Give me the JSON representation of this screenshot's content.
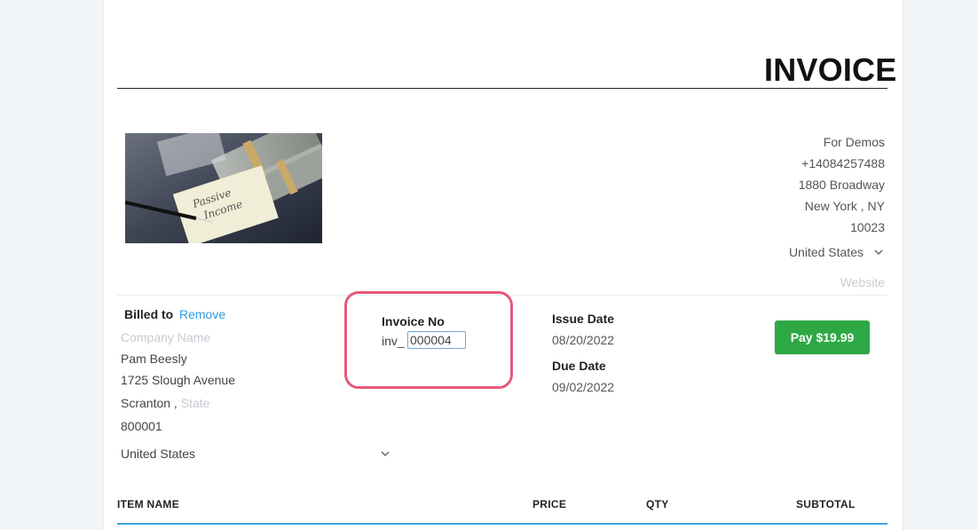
{
  "invoice": {
    "title": "INVOICE"
  },
  "company": {
    "name": "For Demos",
    "phone": "+14084257488",
    "address": "1880 Broadway",
    "city": "New York",
    "state": "NY",
    "zip": "10023",
    "country": "United States",
    "website_placeholder": "Website"
  },
  "billed_to": {
    "label": "Billed to",
    "remove_label": "Remove",
    "company_placeholder": "Company Name",
    "name": "Pam Beesly",
    "address": "1725 Slough Avenue",
    "city": "Scranton",
    "state_placeholder": "State",
    "zip": "800001",
    "country": "United States"
  },
  "invoice_no": {
    "label": "Invoice No",
    "prefix": "inv_",
    "value": "000004"
  },
  "dates": {
    "issue_label": "Issue Date",
    "issue_value": "08/20/2022",
    "due_label": "Due Date",
    "due_value": "09/02/2022"
  },
  "pay_button": {
    "label": "Pay $19.99"
  },
  "table": {
    "columns": [
      "ITEM NAME",
      "PRICE",
      "QTY",
      "SUBTOTAL"
    ]
  },
  "colors": {
    "accent_blue": "#2f9be6",
    "pay_green": "#2ea844",
    "highlight_pink": "#e8587a"
  },
  "logo": {
    "note_text": "Passive Income"
  }
}
